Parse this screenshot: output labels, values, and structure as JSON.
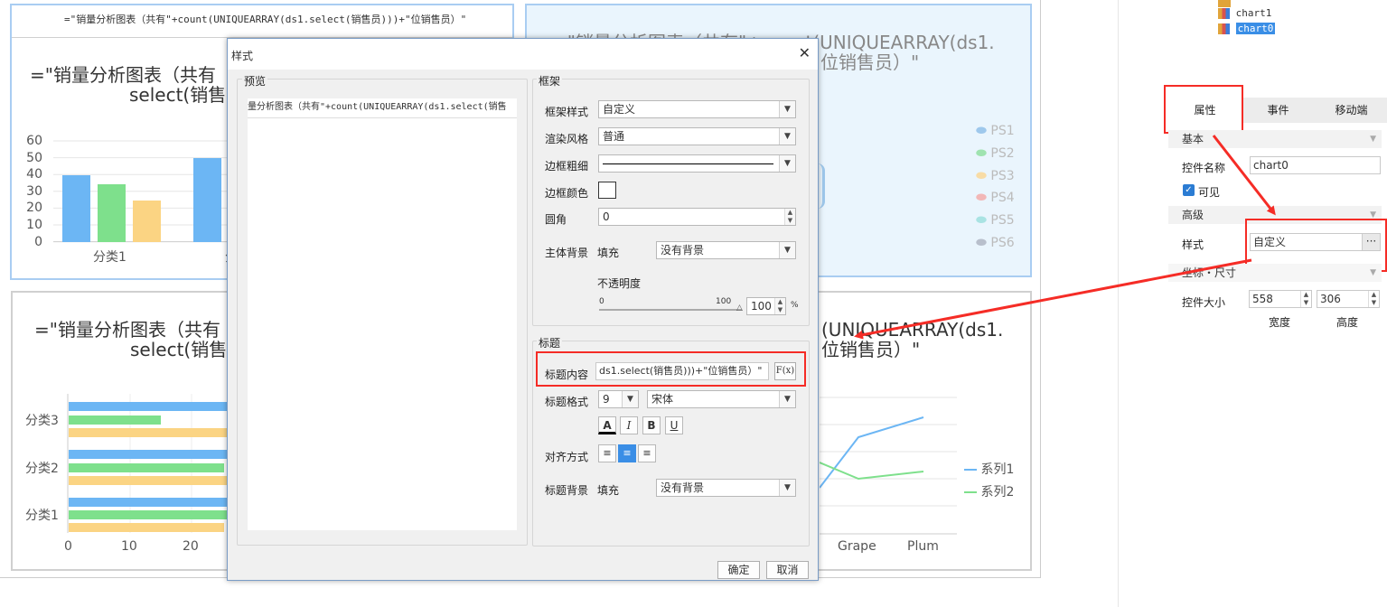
{
  "canvas": {
    "chart_top_left": {
      "header_formula": "=\"销量分析图表（共有\"+count(UNIQUEARRAY(ds1.select(销售员)))+\"位销售员）\"",
      "title_line1": "=\"销量分析图表（共有",
      "title_line2": "select(销售",
      "y_ticks": [
        "60",
        "50",
        "40",
        "30",
        "20",
        "10",
        "0"
      ],
      "x_label": "分类1",
      "x_label_partial": "分"
    },
    "chart_top_right": {
      "title_line1": "=\"销量分析图表（共有\"+count(UNIQUEARRAY(ds1.",
      "title_line2": "位销售员）\"",
      "legend": [
        "PS1",
        "PS2",
        "PS3",
        "PS4",
        "PS5",
        "PS6"
      ]
    },
    "chart_bottom_left": {
      "title_line1": "=\"销量分析图表（共有",
      "title_line2": "select(销售",
      "categories": [
        "分类3",
        "分类2",
        "分类1"
      ],
      "x_ticks": [
        "0",
        "10",
        "20"
      ]
    },
    "chart_bottom_right": {
      "title_line1": "(UNIQUEARRAY(ds1.",
      "title_line2": "位销售员）\"",
      "x_labels": [
        "Grape",
        "Plum"
      ],
      "legend": [
        "系列1",
        "系列2"
      ]
    }
  },
  "right_panel": {
    "tree": [
      "chart1",
      "chart0"
    ],
    "tabs": [
      "属性",
      "事件",
      "移动端"
    ],
    "sections": {
      "basic": "基本",
      "advanced": "高级",
      "coords": "坐标・尺寸"
    },
    "name_label": "控件名称",
    "name_value": "chart0",
    "visible_label": "可见",
    "style_label": "样式",
    "style_value": "自定义",
    "size_label": "控件大小",
    "width_value": "558",
    "height_value": "306",
    "width_label": "宽度",
    "height_label": "高度"
  },
  "dialog": {
    "title": "样式",
    "preview_label": "预览",
    "preview_text": "量分析图表（共有\"+count(UNIQUEARRAY(ds1.select(销售",
    "frame_group": "框架",
    "frame_style_label": "框架样式",
    "frame_style_value": "自定义",
    "render_label": "渲染风格",
    "render_value": "普通",
    "border_width_label": "边框粗细",
    "border_color_label": "边框颜色",
    "radius_label": "圆角",
    "radius_value": "0",
    "body_bg_label": "主体背景",
    "fill_label": "填充",
    "body_bg_value": "没有背景",
    "opacity_label": "不透明度",
    "opacity_min": "0",
    "opacity_max": "100",
    "opacity_value": "100",
    "percent": "%",
    "title_group": "标题",
    "title_content_label": "标题内容",
    "title_content_value": "ds1.select(销售员)))+\"位销售员）\"",
    "formula_btn": "F(x)",
    "title_format_label": "标题格式",
    "font_size": "9",
    "font_name": "宋体",
    "align_label": "对齐方式",
    "title_bg_label": "标题背景",
    "title_fill_label": "填充",
    "title_bg_value": "没有背景",
    "ok": "确定",
    "cancel": "取消"
  },
  "colors": {
    "blue": "#6cb6f4",
    "green": "#7ee08c",
    "yellow": "#fbd483",
    "highlight_red": "#f52c26"
  }
}
